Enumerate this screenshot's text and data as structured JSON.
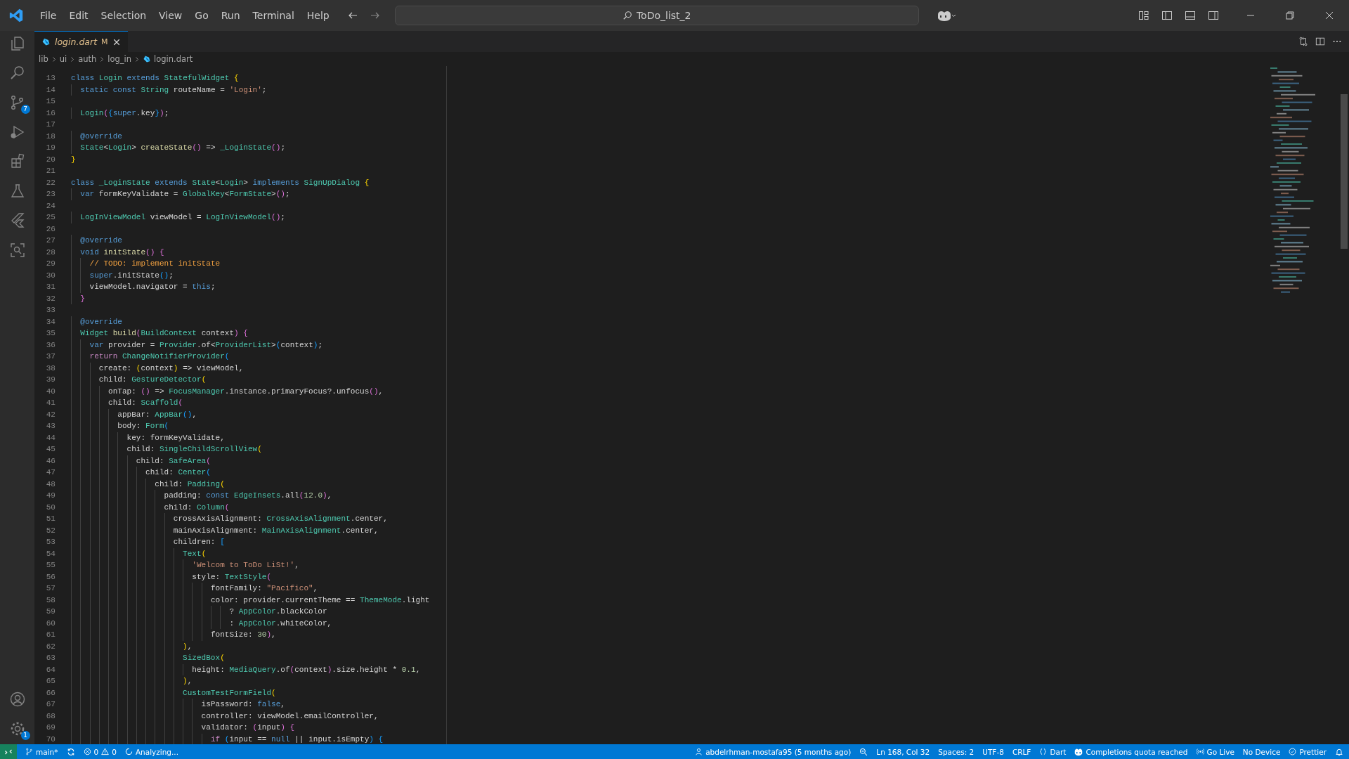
{
  "title_bar": {
    "menus": [
      "File",
      "Edit",
      "Selection",
      "View",
      "Go",
      "Run",
      "Terminal",
      "Help"
    ],
    "search": "ToDo_list_2"
  },
  "activity_bar": {
    "source_control_badge": "7",
    "manage_badge": "1"
  },
  "tabs": [
    {
      "label": "login.dart",
      "badge": "M",
      "selected": true
    }
  ],
  "breadcrumb": [
    "lib",
    "ui",
    "auth",
    "log_in",
    "login.dart"
  ],
  "editor": {
    "lines": [
      {
        "number": "13",
        "tokens": [
          {
            "kind": "kw",
            "text": "class "
          },
          {
            "kind": "type",
            "text": "Login "
          },
          {
            "kind": "kw",
            "text": "extends "
          },
          {
            "kind": "type",
            "text": "StatefulWidget "
          },
          {
            "kind": "b1",
            "text": "{"
          }
        ]
      },
      {
        "number": "14",
        "tokens": [
          {
            "kind": "kw",
            "text": "  static const "
          },
          {
            "kind": "type",
            "text": "String "
          },
          {
            "kind": "p",
            "text": "routeName = "
          },
          {
            "kind": "str",
            "text": "'Login'"
          },
          {
            "kind": "p",
            "text": ";"
          }
        ]
      },
      {
        "number": "15"
      },
      {
        "number": "16",
        "tokens": [
          {
            "kind": "type",
            "text": "  Login"
          },
          {
            "kind": "b2",
            "text": "("
          },
          {
            "kind": "b3",
            "text": "{"
          },
          {
            "kind": "kw",
            "text": "super"
          },
          {
            "kind": "p",
            "text": ".key"
          },
          {
            "kind": "b3",
            "text": "}"
          },
          {
            "kind": "b2",
            "text": ")"
          },
          {
            "kind": "p",
            "text": ";"
          }
        ]
      },
      {
        "number": "17"
      },
      {
        "number": "18",
        "tokens": [
          {
            "kind": "kw",
            "text": "  @override"
          }
        ]
      },
      {
        "number": "19",
        "tokens": [
          {
            "kind": "type",
            "text": "  State"
          },
          {
            "kind": "p",
            "text": "<"
          },
          {
            "kind": "type",
            "text": "Login"
          },
          {
            "kind": "p",
            "text": "> "
          },
          {
            "kind": "fn",
            "text": "createState"
          },
          {
            "kind": "b2",
            "text": "()"
          },
          {
            "kind": "p",
            "text": " => "
          },
          {
            "kind": "type",
            "text": "_LoginState"
          },
          {
            "kind": "b2",
            "text": "()"
          },
          {
            "kind": "p",
            "text": ";"
          }
        ]
      },
      {
        "number": "20",
        "tokens": [
          {
            "kind": "b1",
            "text": "}"
          }
        ]
      },
      {
        "number": "21"
      },
      {
        "number": "22",
        "tokens": [
          {
            "kind": "kw",
            "text": "class "
          },
          {
            "kind": "type",
            "text": "_LoginState "
          },
          {
            "kind": "kw",
            "text": "extends "
          },
          {
            "kind": "type",
            "text": "State"
          },
          {
            "kind": "p",
            "text": "<"
          },
          {
            "kind": "type",
            "text": "Login"
          },
          {
            "kind": "p",
            "text": "> "
          },
          {
            "kind": "kw",
            "text": "implements "
          },
          {
            "kind": "type",
            "text": "SignUpDialog "
          },
          {
            "kind": "b1",
            "text": "{"
          }
        ]
      },
      {
        "number": "23",
        "tokens": [
          {
            "kind": "kw",
            "text": "  var "
          },
          {
            "kind": "p",
            "text": "formKeyValidate = "
          },
          {
            "kind": "type",
            "text": "GlobalKey"
          },
          {
            "kind": "p",
            "text": "<"
          },
          {
            "kind": "type",
            "text": "FormState"
          },
          {
            "kind": "p",
            "text": ">"
          },
          {
            "kind": "b2",
            "text": "()"
          },
          {
            "kind": "p",
            "text": ";"
          }
        ]
      },
      {
        "number": "24"
      },
      {
        "number": "25",
        "tokens": [
          {
            "kind": "type",
            "text": "  LogInViewModel "
          },
          {
            "kind": "p",
            "text": "viewModel = "
          },
          {
            "kind": "type",
            "text": "LogInViewModel"
          },
          {
            "kind": "b2",
            "text": "()"
          },
          {
            "kind": "p",
            "text": ";"
          }
        ]
      },
      {
        "number": "26"
      },
      {
        "number": "27",
        "tokens": [
          {
            "kind": "kw",
            "text": "  @override"
          }
        ]
      },
      {
        "number": "28",
        "tokens": [
          {
            "kind": "kw",
            "text": "  void "
          },
          {
            "kind": "fn",
            "text": "initState"
          },
          {
            "kind": "b2",
            "text": "() {"
          }
        ]
      },
      {
        "number": "29",
        "tokens": [
          {
            "kind": "cmt",
            "text": "    // TODO: implement initState"
          }
        ]
      },
      {
        "number": "30",
        "tokens": [
          {
            "kind": "kw",
            "text": "    super"
          },
          {
            "kind": "p",
            "text": ".initState"
          },
          {
            "kind": "b3",
            "text": "()"
          },
          {
            "kind": "p",
            "text": ";"
          }
        ]
      },
      {
        "number": "31",
        "tokens": [
          {
            "kind": "p",
            "text": "    viewModel.navigator = "
          },
          {
            "kind": "kw",
            "text": "this"
          },
          {
            "kind": "p",
            "text": ";"
          }
        ]
      },
      {
        "number": "32",
        "tokens": [
          {
            "kind": "b2",
            "text": "  }"
          }
        ]
      },
      {
        "number": "33"
      },
      {
        "number": "34",
        "tokens": [
          {
            "kind": "kw",
            "text": "  @override"
          }
        ]
      },
      {
        "number": "35",
        "tokens": [
          {
            "kind": "type",
            "text": "  Widget "
          },
          {
            "kind": "fn",
            "text": "build"
          },
          {
            "kind": "b2",
            "text": "("
          },
          {
            "kind": "type",
            "text": "BuildContext "
          },
          {
            "kind": "p",
            "text": "context"
          },
          {
            "kind": "b2",
            "text": ") {"
          }
        ]
      },
      {
        "number": "36",
        "tokens": [
          {
            "kind": "kw",
            "text": "    var "
          },
          {
            "kind": "p",
            "text": "provider = "
          },
          {
            "kind": "type",
            "text": "Provider"
          },
          {
            "kind": "p",
            "text": ".of<"
          },
          {
            "kind": "type",
            "text": "ProviderList"
          },
          {
            "kind": "p",
            "text": ">"
          },
          {
            "kind": "b3",
            "text": "("
          },
          {
            "kind": "p",
            "text": "context"
          },
          {
            "kind": "b3",
            "text": ")"
          },
          {
            "kind": "p",
            "text": ";"
          }
        ]
      },
      {
        "number": "37",
        "tokens": [
          {
            "kind": "ctl",
            "text": "    return "
          },
          {
            "kind": "type",
            "text": "ChangeNotifierProvider"
          },
          {
            "kind": "b3",
            "text": "("
          }
        ]
      },
      {
        "number": "38",
        "tokens": [
          {
            "kind": "p",
            "text": "      create: "
          },
          {
            "kind": "b1",
            "text": "("
          },
          {
            "kind": "p",
            "text": "context"
          },
          {
            "kind": "b1",
            "text": ")"
          },
          {
            "kind": "p",
            "text": " => viewModel,"
          }
        ]
      },
      {
        "number": "39",
        "tokens": [
          {
            "kind": "p",
            "text": "      child: "
          },
          {
            "kind": "type",
            "text": "GestureDetector"
          },
          {
            "kind": "b1",
            "text": "("
          }
        ]
      },
      {
        "number": "40",
        "tokens": [
          {
            "kind": "p",
            "text": "        onTap: "
          },
          {
            "kind": "b2",
            "text": "()"
          },
          {
            "kind": "p",
            "text": " => "
          },
          {
            "kind": "type",
            "text": "FocusManager"
          },
          {
            "kind": "p",
            "text": ".instance.primaryFocus?.unfocus"
          },
          {
            "kind": "b2",
            "text": "()"
          },
          {
            "kind": "p",
            "text": ","
          }
        ]
      },
      {
        "number": "41",
        "tokens": [
          {
            "kind": "p",
            "text": "        child: "
          },
          {
            "kind": "type",
            "text": "Scaffold"
          },
          {
            "kind": "b2",
            "text": "("
          }
        ]
      },
      {
        "number": "42",
        "tokens": [
          {
            "kind": "p",
            "text": "          appBar: "
          },
          {
            "kind": "type",
            "text": "AppBar"
          },
          {
            "kind": "b3",
            "text": "()"
          },
          {
            "kind": "p",
            "text": ","
          }
        ]
      },
      {
        "number": "43",
        "tokens": [
          {
            "kind": "p",
            "text": "          body: "
          },
          {
            "kind": "type",
            "text": "Form"
          },
          {
            "kind": "b3",
            "text": "("
          }
        ]
      },
      {
        "number": "44",
        "tokens": [
          {
            "kind": "p",
            "text": "            key: formKeyValidate,"
          }
        ]
      },
      {
        "number": "45",
        "tokens": [
          {
            "kind": "p",
            "text": "            child: "
          },
          {
            "kind": "type",
            "text": "SingleChildScrollView"
          },
          {
            "kind": "b1",
            "text": "("
          }
        ]
      },
      {
        "number": "46",
        "tokens": [
          {
            "kind": "p",
            "text": "              child: "
          },
          {
            "kind": "type",
            "text": "SafeArea"
          },
          {
            "kind": "b2",
            "text": "("
          }
        ]
      },
      {
        "number": "47",
        "tokens": [
          {
            "kind": "p",
            "text": "                child: "
          },
          {
            "kind": "type",
            "text": "Center"
          },
          {
            "kind": "b3",
            "text": "("
          }
        ]
      },
      {
        "number": "48",
        "tokens": [
          {
            "kind": "p",
            "text": "                  child: "
          },
          {
            "kind": "type",
            "text": "Padding"
          },
          {
            "kind": "b1",
            "text": "("
          }
        ]
      },
      {
        "number": "49",
        "tokens": [
          {
            "kind": "p",
            "text": "                    padding: "
          },
          {
            "kind": "kw",
            "text": "const "
          },
          {
            "kind": "type",
            "text": "EdgeInsets"
          },
          {
            "kind": "p",
            "text": ".all"
          },
          {
            "kind": "b2",
            "text": "("
          },
          {
            "kind": "num",
            "text": "12.0"
          },
          {
            "kind": "b2",
            "text": ")"
          },
          {
            "kind": "p",
            "text": ","
          }
        ]
      },
      {
        "number": "50",
        "tokens": [
          {
            "kind": "p",
            "text": "                    child: "
          },
          {
            "kind": "type",
            "text": "Column"
          },
          {
            "kind": "b2",
            "text": "("
          }
        ]
      },
      {
        "number": "51",
        "tokens": [
          {
            "kind": "p",
            "text": "                      crossAxisAlignment: "
          },
          {
            "kind": "type",
            "text": "CrossAxisAlignment"
          },
          {
            "kind": "p",
            "text": ".center,"
          }
        ]
      },
      {
        "number": "52",
        "tokens": [
          {
            "kind": "p",
            "text": "                      mainAxisAlignment: "
          },
          {
            "kind": "type",
            "text": "MainAxisAlignment"
          },
          {
            "kind": "p",
            "text": ".center,"
          }
        ]
      },
      {
        "number": "53",
        "tokens": [
          {
            "kind": "p",
            "text": "                      children: "
          },
          {
            "kind": "b3",
            "text": "["
          }
        ]
      },
      {
        "number": "54",
        "tokens": [
          {
            "kind": "type",
            "text": "                        Text"
          },
          {
            "kind": "b1",
            "text": "("
          }
        ]
      },
      {
        "number": "55",
        "tokens": [
          {
            "kind": "str",
            "text": "                          'Welcom to ToDo LiSt!'"
          },
          {
            "kind": "p",
            "text": ","
          }
        ]
      },
      {
        "number": "56",
        "tokens": [
          {
            "kind": "p",
            "text": "                          style: "
          },
          {
            "kind": "type",
            "text": "TextStyle"
          },
          {
            "kind": "b2",
            "text": "("
          }
        ]
      },
      {
        "number": "57",
        "tokens": [
          {
            "kind": "p",
            "text": "                              fontFamily: "
          },
          {
            "kind": "str",
            "text": "\"Pacifico\""
          },
          {
            "kind": "p",
            "text": ","
          }
        ]
      },
      {
        "number": "58",
        "tokens": [
          {
            "kind": "p",
            "text": "                              color: provider.currentTheme == "
          },
          {
            "kind": "type",
            "text": "ThemeMode"
          },
          {
            "kind": "p",
            "text": ".light"
          }
        ]
      },
      {
        "number": "59",
        "tokens": [
          {
            "kind": "p",
            "text": "                                  ? "
          },
          {
            "kind": "type",
            "text": "AppColor"
          },
          {
            "kind": "p",
            "text": ".blackColor"
          }
        ]
      },
      {
        "number": "60",
        "tokens": [
          {
            "kind": "p",
            "text": "                                  : "
          },
          {
            "kind": "type",
            "text": "AppColor"
          },
          {
            "kind": "p",
            "text": ".whiteColor,"
          }
        ]
      },
      {
        "number": "61",
        "tokens": [
          {
            "kind": "p",
            "text": "                              fontSize: "
          },
          {
            "kind": "num",
            "text": "30"
          },
          {
            "kind": "b2",
            "text": ")"
          },
          {
            "kind": "p",
            "text": ","
          }
        ]
      },
      {
        "number": "62",
        "tokens": [
          {
            "kind": "b1",
            "text": "                        )"
          },
          {
            "kind": "p",
            "text": ","
          }
        ]
      },
      {
        "number": "63",
        "tokens": [
          {
            "kind": "type",
            "text": "                        SizedBox"
          },
          {
            "kind": "b1",
            "text": "("
          }
        ]
      },
      {
        "number": "64",
        "tokens": [
          {
            "kind": "p",
            "text": "                          height: "
          },
          {
            "kind": "type",
            "text": "MediaQuery"
          },
          {
            "kind": "p",
            "text": ".of"
          },
          {
            "kind": "b2",
            "text": "("
          },
          {
            "kind": "p",
            "text": "context"
          },
          {
            "kind": "b2",
            "text": ")"
          },
          {
            "kind": "p",
            "text": ".size.height * "
          },
          {
            "kind": "num",
            "text": "0.1"
          },
          {
            "kind": "p",
            "text": ","
          }
        ]
      },
      {
        "number": "65",
        "tokens": [
          {
            "kind": "b1",
            "text": "                        )"
          },
          {
            "kind": "p",
            "text": ","
          }
        ]
      },
      {
        "number": "66",
        "tokens": [
          {
            "kind": "type",
            "text": "                        CustomTestFormField"
          },
          {
            "kind": "b1",
            "text": "("
          }
        ]
      },
      {
        "number": "67",
        "tokens": [
          {
            "kind": "p",
            "text": "                            isPassword: "
          },
          {
            "kind": "kw",
            "text": "false"
          },
          {
            "kind": "p",
            "text": ","
          }
        ]
      },
      {
        "number": "68",
        "tokens": [
          {
            "kind": "p",
            "text": "                            controller: viewModel.emailController,"
          }
        ]
      },
      {
        "number": "69",
        "tokens": [
          {
            "kind": "p",
            "text": "                            validator: "
          },
          {
            "kind": "b2",
            "text": "("
          },
          {
            "kind": "p",
            "text": "input"
          },
          {
            "kind": "b2",
            "text": ") {"
          }
        ]
      },
      {
        "number": "70",
        "tokens": [
          {
            "kind": "ctl",
            "text": "                              if "
          },
          {
            "kind": "b3",
            "text": "("
          },
          {
            "kind": "p",
            "text": "input == "
          },
          {
            "kind": "kw",
            "text": "null"
          },
          {
            "kind": "p",
            "text": " || input.isEmpty"
          },
          {
            "kind": "b3",
            "text": ") {"
          }
        ]
      }
    ]
  },
  "status_bar": {
    "left": [
      {
        "kind": "remote"
      },
      {
        "kind": "branch",
        "text": "main*"
      },
      {
        "kind": "sync"
      },
      {
        "kind": "problems",
        "errors": "0",
        "warnings": "0"
      },
      {
        "kind": "progress",
        "text": "Analyzing..."
      }
    ],
    "right": [
      {
        "kind": "blame",
        "text": "abdelrhman-mostafa95 (5 months ago)"
      },
      {
        "kind": "zoom"
      },
      {
        "kind": "plain",
        "text": "Ln 168, Col 32"
      },
      {
        "kind": "plain",
        "text": "Spaces: 2"
      },
      {
        "kind": "plain",
        "text": "UTF-8"
      },
      {
        "kind": "plain",
        "text": "CRLF"
      },
      {
        "kind": "braces",
        "text": "Dart"
      },
      {
        "kind": "copilot",
        "text": "Completions quota reached"
      },
      {
        "kind": "broadcast",
        "text": "Go Live"
      },
      {
        "kind": "plain",
        "text": "No Device"
      },
      {
        "kind": "check",
        "text": "Prettier"
      },
      {
        "kind": "bell"
      }
    ]
  }
}
